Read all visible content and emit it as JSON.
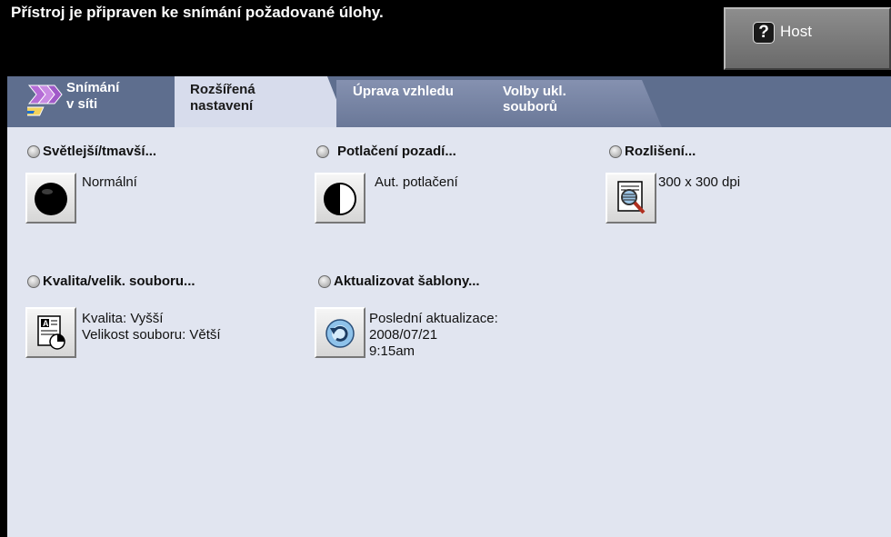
{
  "status": {
    "message": "Přístroj je připraven ke snímání požadované úlohy.",
    "user_label": "Host",
    "user_icon": "question-mark-icon"
  },
  "tabs": [
    {
      "label_line1": "Snímání",
      "label_line2": "v síti",
      "icon": "network-scan-icon",
      "active": false
    },
    {
      "label_line1": "Rozšířená",
      "label_line2": "nastavení",
      "active": true
    },
    {
      "label_line1": "Úprava vzhledu",
      "label_line2": "",
      "active": false
    },
    {
      "label_line1": "Volby ukl.",
      "label_line2": "souborů",
      "active": false
    }
  ],
  "options": {
    "lighten_darken": {
      "title": "Světlejší/tmavší...",
      "value": "Normální",
      "icon": "black-circle-icon"
    },
    "background_suppression": {
      "title": "Potlačení pozadí...",
      "value": "Aut. potlačení",
      "icon": "half-circle-icon"
    },
    "resolution": {
      "title": "Rozlišení...",
      "value": "300 x 300 dpi",
      "icon": "magnifier-document-icon"
    },
    "quality_filesize": {
      "title": "Kvalita/velik. souboru...",
      "value_line1": "Kvalita: Vyšší",
      "value_line2": "Velikost souboru: Větší",
      "icon": "document-quality-icon"
    },
    "update_templates": {
      "title": "Aktualizovat šablony...",
      "value_line1": "Poslední aktualizace:",
      "value_line2": "2008/07/21",
      "value_line3": "9:15am",
      "icon": "refresh-icon"
    }
  },
  "colors": {
    "tab_band": "#5e6e8e",
    "content_bg": "#e1e5f0",
    "active_tab": "#d7dcec",
    "status_bg": "#000000"
  }
}
